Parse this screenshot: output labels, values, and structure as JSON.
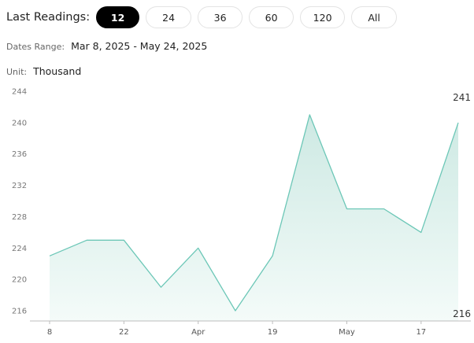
{
  "header": {
    "label": "Last Readings:",
    "options": [
      "12",
      "24",
      "36",
      "60",
      "120",
      "All"
    ],
    "selected": "12"
  },
  "dates_range": {
    "label": "Dates Range:",
    "value": "Mar 8, 2025 - May 24, 2025"
  },
  "unit": {
    "label": "Unit:",
    "value": "Thousand"
  },
  "colors": {
    "line": "#6cc7b7",
    "fill_top": "#cde9e3",
    "fill_bottom": "#f4fbf9",
    "active_pill": "#000000"
  },
  "chart_data": {
    "type": "area",
    "x": [
      "2025-03-08",
      "2025-03-15",
      "2025-03-22",
      "2025-03-29",
      "2025-04-05",
      "2025-04-12",
      "2025-04-19",
      "2025-04-26",
      "2025-05-03",
      "2025-05-10",
      "2025-05-17",
      "2025-05-24"
    ],
    "values": [
      223,
      225,
      225,
      219,
      224,
      216,
      223,
      241,
      229,
      229,
      226,
      240
    ],
    "ylim": [
      215,
      245
    ],
    "yticks": [
      216,
      220,
      224,
      228,
      232,
      236,
      240,
      244
    ],
    "xticks": [
      {
        "x": "2025-03-08",
        "label": "8"
      },
      {
        "x": "2025-03-22",
        "label": "22"
      },
      {
        "x": "2025-04-05",
        "label": "Apr"
      },
      {
        "x": "2025-04-19",
        "label": "19"
      },
      {
        "x": "2025-05-03",
        "label": "May"
      },
      {
        "x": "2025-05-17",
        "label": "17"
      }
    ],
    "max_label": "241",
    "min_label": "216",
    "grid": false
  }
}
